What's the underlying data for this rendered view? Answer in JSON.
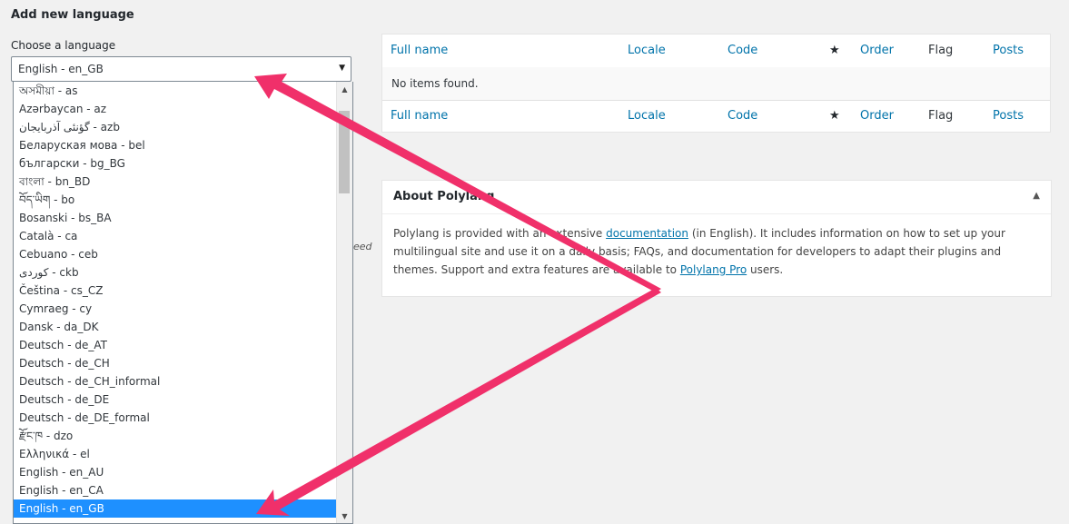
{
  "page": {
    "section_title": "Add new language",
    "choose_label": "Choose a language",
    "selected_value": "English - en_GB",
    "background_peek": "eed"
  },
  "dropdown": {
    "items": [
      "অসমীয়া - as",
      "Azərbaycan - az",
      "گؤنئی آذربایجان - azb",
      "Беларуская мова - bel",
      "български - bg_BG",
      "বাংলা - bn_BD",
      "བོད་ཡིག - bo",
      "Bosanski - bs_BA",
      "Català - ca",
      "Cebuano - ceb",
      "كوردی - ckb",
      "Čeština - cs_CZ",
      "Cymraeg - cy",
      "Dansk - da_DK",
      "Deutsch - de_AT",
      "Deutsch - de_CH",
      "Deutsch - de_CH_informal",
      "Deutsch - de_DE",
      "Deutsch - de_DE_formal",
      "རྫོང་ཁ - dzo",
      "Ελληνικά - el",
      "English - en_AU",
      "English - en_CA",
      "English - en_GB"
    ],
    "selected_index": 23
  },
  "table": {
    "columns": [
      "Full name",
      "Locale",
      "Code",
      "★",
      "Order",
      "Flag",
      "Posts"
    ],
    "empty_message": "No items found."
  },
  "about": {
    "title": "About Polylang",
    "text_1": "Polylang is provided with an extensive ",
    "link_1": "documentation",
    "text_2": " (in English). It includes information on how to set up your multilingual site and use it on a daily basis; FAQs, and documentation for developers to adapt their plugins and themes. Support and extra features are available to ",
    "link_2": "Polylang Pro",
    "text_3": " users."
  },
  "colors": {
    "accent_link": "#0073aa",
    "selection": "#1e90ff",
    "arrow": "#f0306a"
  }
}
